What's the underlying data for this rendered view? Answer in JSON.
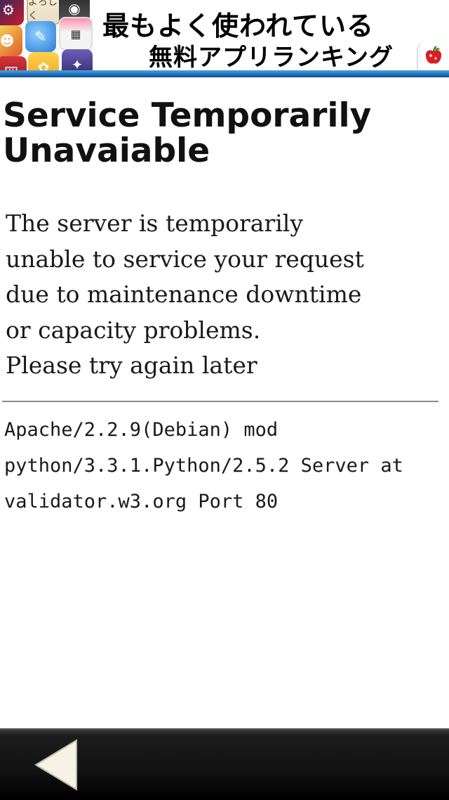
{
  "banner": {
    "headline": "最もよく使われている",
    "subline": "無料アプリランキング",
    "tiles": [
      {
        "icon": "robot-app-icon",
        "glyph": "⚙"
      },
      {
        "icon": "yoroshiku-app-icon",
        "glyph": "よろしく"
      },
      {
        "icon": "camera-app-icon",
        "glyph": "◉"
      },
      {
        "icon": "character-app-icon",
        "glyph": "☻"
      },
      {
        "icon": "palette-app-icon",
        "glyph": "✎"
      },
      {
        "icon": "calendar-app-icon",
        "glyph": "▦"
      },
      {
        "icon": "book-app-icon",
        "glyph": "囲"
      },
      {
        "icon": "chick-app-icon",
        "glyph": "✿"
      },
      {
        "icon": "anime-app-icon",
        "glyph": "✦"
      }
    ],
    "logo_icon": "apple-logo-icon",
    "accent_color": "#1c6fb8"
  },
  "page": {
    "title": "Service Temporarily Unavaiable",
    "message_lines": [
      "The server is temporarily",
      "unable to service your request",
      "due to maintenance downtime",
      "or capacity problems.",
      "Please try again later"
    ],
    "server_info_lines": [
      "Apache/2.2.9(Debian) mod",
      "python/3.3.1.Python/2.5.2 Server at",
      "validator.w3.org Port 80"
    ]
  },
  "toolbar": {
    "back_icon": "back-arrow-icon"
  }
}
